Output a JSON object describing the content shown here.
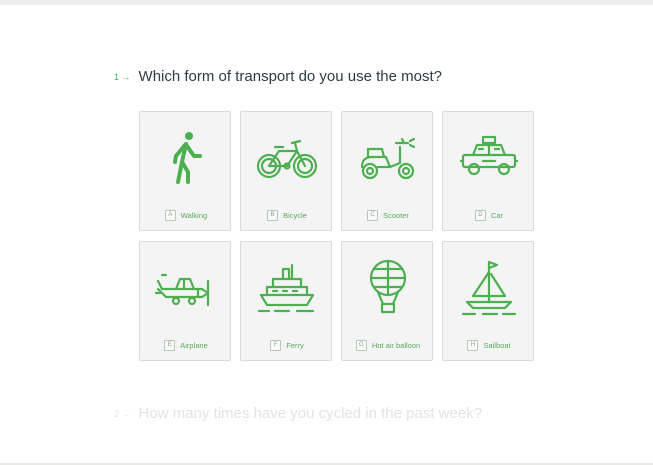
{
  "questions": [
    {
      "number": "1",
      "arrow": "→",
      "text": "Which form of transport do you use the most?",
      "options": [
        {
          "key": "A",
          "label": "Walking",
          "icon": "walking-person-icon"
        },
        {
          "key": "B",
          "label": "Bicycle",
          "icon": "bicycle-icon"
        },
        {
          "key": "C",
          "label": "Scooter",
          "icon": "scooter-icon"
        },
        {
          "key": "D",
          "label": "Car",
          "icon": "taxi-car-icon"
        },
        {
          "key": "E",
          "label": "Airplane",
          "icon": "airplane-icon"
        },
        {
          "key": "F",
          "label": "Ferry",
          "icon": "ferry-icon"
        },
        {
          "key": "G",
          "label": "Hot air balloon",
          "icon": "hot-air-balloon-icon"
        },
        {
          "key": "H",
          "label": "Sailboat",
          "icon": "sailboat-icon"
        }
      ]
    },
    {
      "number": "2",
      "arrow": "→",
      "text": "How many times have you cycled in the past week?"
    }
  ],
  "colors": {
    "accent": "#4caf50",
    "card_bg": "#f4f4f4",
    "card_border": "#dadada"
  }
}
